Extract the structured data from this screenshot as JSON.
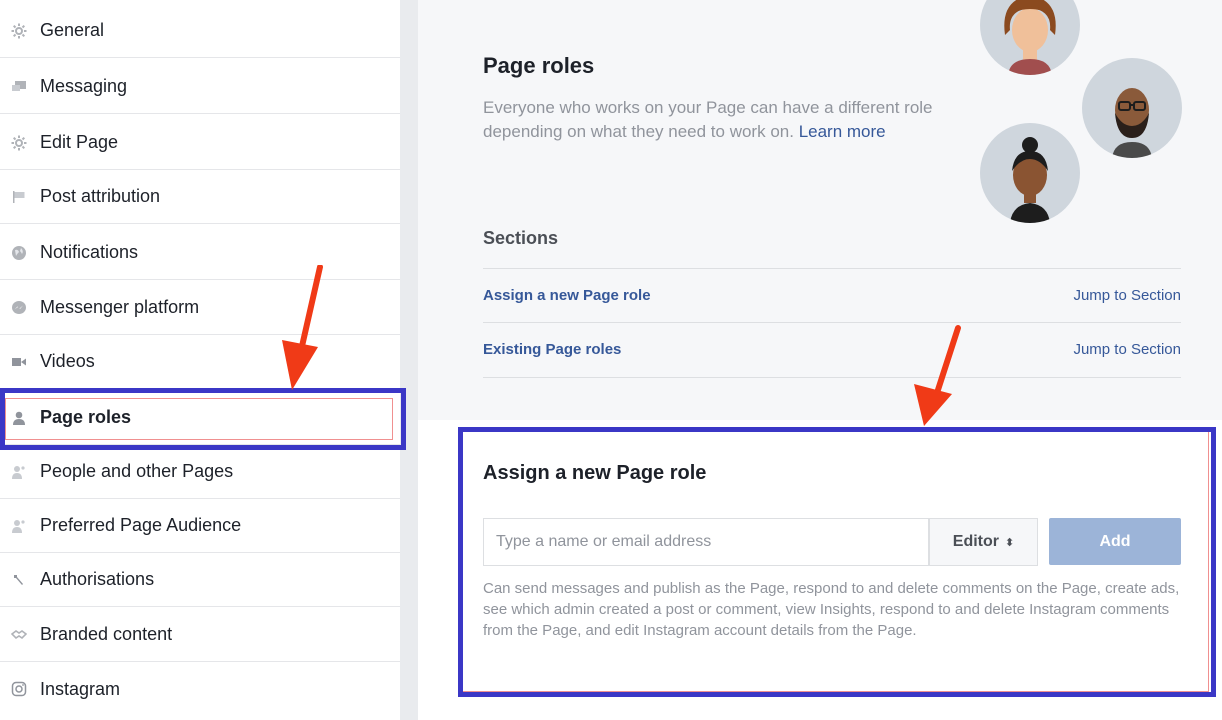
{
  "sidebar": {
    "items": [
      {
        "label": "General",
        "icon": "gear-icon"
      },
      {
        "label": "Messaging",
        "icon": "chat-bubbles-icon"
      },
      {
        "label": "Edit Page",
        "icon": "gear-icon"
      },
      {
        "label": "Post attribution",
        "icon": "flag-icon"
      },
      {
        "label": "Notifications",
        "icon": "globe-icon"
      },
      {
        "label": "Messenger platform",
        "icon": "messenger-icon"
      },
      {
        "label": "Videos",
        "icon": "video-camera-icon"
      },
      {
        "label": "Page roles",
        "icon": "person-icon",
        "active": true
      },
      {
        "label": "People and other Pages",
        "icon": "people-icon"
      },
      {
        "label": "Preferred Page Audience",
        "icon": "people-icon"
      },
      {
        "label": "Authorisations",
        "icon": "wrench-icon"
      },
      {
        "label": "Branded content",
        "icon": "handshake-icon"
      },
      {
        "label": "Instagram",
        "icon": "instagram-icon"
      }
    ]
  },
  "page_roles": {
    "title": "Page roles",
    "description": "Everyone who works on your Page can have a different role depending on what they need to work on.",
    "learn_more": "Learn more"
  },
  "sections": {
    "title": "Sections",
    "rows": [
      {
        "label": "Assign a new Page role",
        "link": "Jump to Section"
      },
      {
        "label": "Existing Page roles",
        "link": "Jump to Section"
      }
    ]
  },
  "assign": {
    "title": "Assign a new Page role",
    "input_placeholder": "Type a name or email address",
    "role_selected": "Editor",
    "add_label": "Add",
    "help_text": "Can send messages and publish as the Page, respond to and delete comments on the Page, create ads, see which admin created a post or comment, view Insights, respond to and delete Instagram comments from the Page, and edit Instagram account details from the Page."
  },
  "colors": {
    "link": "#365899",
    "highlight": "#3b37c6",
    "arrow": "#f03a17",
    "add_button": "#9cb4d8"
  }
}
